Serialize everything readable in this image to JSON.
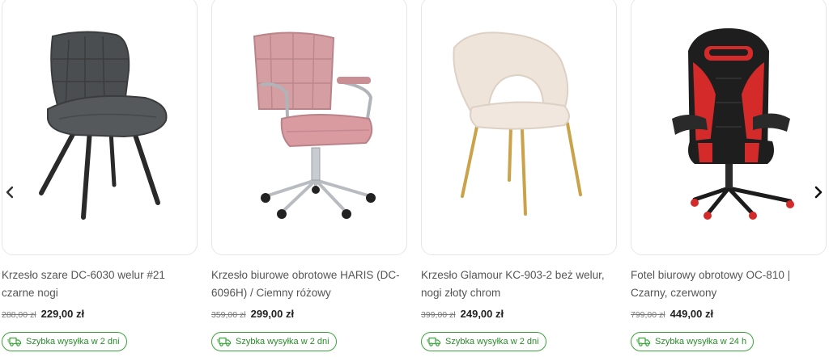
{
  "carousel": {
    "products": [
      {
        "name": "Krzesło szare DC-6030 welur #21 czarne nogi",
        "old_price": "288,00 zł",
        "price": "229,00 zł",
        "shipping": "Szybka wysyłka w 2 dni",
        "image": "grey-velvet-chair"
      },
      {
        "name": "Krzesło biurowe obrotowe HARIS (DC-6096H) / Ciemny różowy",
        "old_price": "359,00 zł",
        "price": "299,00 zł",
        "shipping": "Szybka wysyłka w 2 dni",
        "image": "pink-office-chair"
      },
      {
        "name": "Krzesło Glamour KC-903-2 beż welur, nogi złoty chrom",
        "old_price": "399,00 zł",
        "price": "249,00 zł",
        "shipping": "Szybka wysyłka w 2 dni",
        "image": "beige-glamour-chair"
      },
      {
        "name": "Fotel biurowy obrotowy OC-810 | Czarny, czerwony",
        "old_price": "799,00 zł",
        "price": "449,00 zł",
        "shipping": "Szybka wysyłka w 24 h",
        "image": "gaming-chair"
      }
    ]
  },
  "icons": {
    "prev": "chevron-left-icon",
    "next": "chevron-right-icon",
    "shipping": "delivery-truck-icon"
  },
  "colors": {
    "shipping_accent": "#3aa33a",
    "card_border": "#e6e6e6"
  }
}
